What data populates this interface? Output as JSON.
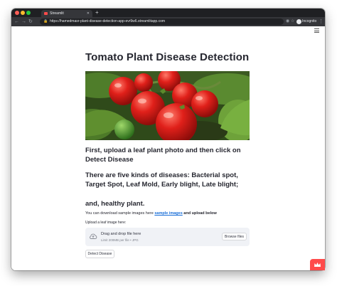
{
  "browser": {
    "tab_title": "Streamlit",
    "tab_close": "✕",
    "new_tab": "+",
    "url": "https://hamedmasr-plant-disease-detection-app-evr9w6.streamlitapp.com",
    "profile_label": "Incognito"
  },
  "page": {
    "title": "Tomato Plant Disease Detection",
    "hero_image_alt": "tomato plant",
    "step1": "First, upload a leaf plant photo and then click on Detect Disease",
    "diseases": "There are five kinds of diseases: Bacterial spot, Target Spot, Leaf Mold, Early blight, Late blight;",
    "healthy": "and, healthy plant.",
    "download_prefix": "You can download sample images here ",
    "download_link": "sample images",
    "download_suffix": " and upload below"
  },
  "uploader": {
    "label": "Upload a leaf image here:",
    "drag_text": "Drag and drop file here",
    "limit_text": "Limit 200MB per file • JPG",
    "browse_label": "Browse files"
  },
  "actions": {
    "detect_label": "Detect Disease"
  },
  "colors": {
    "accent": "#ff4b4b",
    "link": "#1a6fd8",
    "text": "#262730",
    "dropzone_bg": "#f0f2f6"
  }
}
